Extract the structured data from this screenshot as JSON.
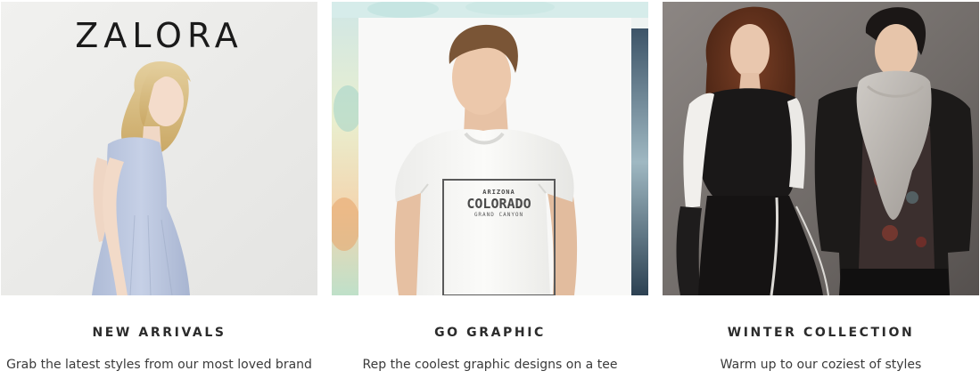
{
  "cards": [
    {
      "logo": "ZALORA",
      "title": "NEW ARRIVALS",
      "description": "Grab the latest styles from our most loved brand"
    },
    {
      "tee_text_small": "ARIZONA",
      "tee_text_main": "COLORADO",
      "tee_text_sub": "GRAND CANYON",
      "title": "GO GRAPHIC",
      "description": "Rep the coolest graphic designs on a tee"
    },
    {
      "title": "WINTER COLLECTION",
      "description": "Warm up to our coziest of styles"
    }
  ]
}
